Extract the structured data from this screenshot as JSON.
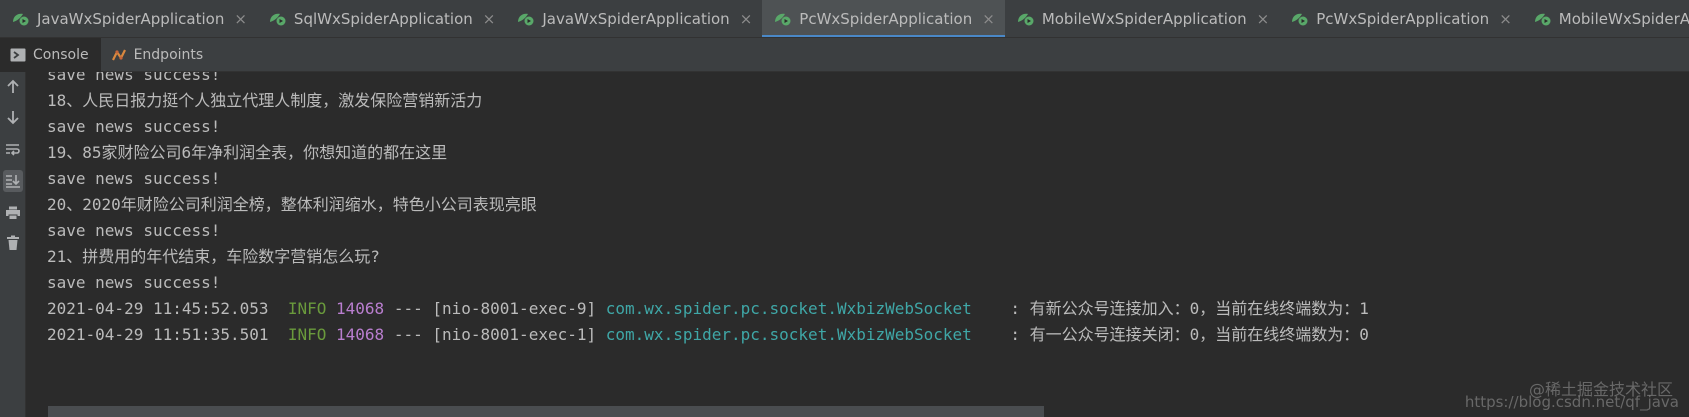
{
  "run_tabs": [
    {
      "label": "JavaWxSpiderApplication",
      "active": false
    },
    {
      "label": "SqlWxSpiderApplication",
      "active": false
    },
    {
      "label": "JavaWxSpiderApplication",
      "active": false
    },
    {
      "label": "PcWxSpiderApplication",
      "active": true
    },
    {
      "label": "MobileWxSpiderApplication",
      "active": false
    },
    {
      "label": "PcWxSpiderApplication",
      "active": false
    },
    {
      "label": "MobileWxSpiderApplication",
      "active": false
    }
  ],
  "tool_tabs": [
    {
      "label": "Console",
      "icon": "console-icon",
      "active": true
    },
    {
      "label": "Endpoints",
      "icon": "endpoints-icon",
      "active": false
    }
  ],
  "gutter_buttons": [
    {
      "name": "up-arrow-icon"
    },
    {
      "name": "down-arrow-icon"
    },
    {
      "name": "soft-wrap-icon"
    },
    {
      "name": "scroll-to-end-icon",
      "pressed": true
    },
    {
      "name": "print-icon"
    },
    {
      "name": "trash-icon"
    }
  ],
  "console": {
    "lines": [
      {
        "text": "save news success!"
      },
      {
        "text": "18、人民日报力挺个人独立代理人制度，激发保险营销新活力"
      },
      {
        "text": "save news success!"
      },
      {
        "text": "19、85家财险公司6年净利润全表，你想知道的都在这里"
      },
      {
        "text": "save news success!"
      },
      {
        "text": "20、2020年财险公司利润全榜，整体利润缩水，特色小公司表现亮眼"
      },
      {
        "text": "save news success!"
      },
      {
        "text": "21、拼费用的年代结束，车险数字营销怎么玩?"
      },
      {
        "text": "save news success!"
      }
    ],
    "log_lines": [
      {
        "timestamp": "2021-04-29 11:45:52.053",
        "level": "INFO",
        "pid": "14068",
        "sep": "---",
        "thread": "[nio-8001-exec-9]",
        "logger": "com.wx.spider.pc.socket.WxbizWebSocket",
        "message": ": 有新公众号连接加入：0，当前在线终端数为：1"
      },
      {
        "timestamp": "2021-04-29 11:51:35.501",
        "level": "INFO",
        "pid": "14068",
        "sep": "---",
        "thread": "[nio-8001-exec-1]",
        "logger": "com.wx.spider.pc.socket.WxbizWebSocket",
        "message": ": 有一公众号连接关闭：0，当前在线终端数为：0"
      }
    ]
  },
  "watermark": {
    "line1": "@稀土掘金技术社区",
    "line2": "https://blog.csdn.net/qf_java"
  },
  "colors": {
    "background": "#2b2b2b",
    "panel": "#3c3f41",
    "accent": "#4a88c7",
    "info": "#6a9a3c",
    "pid": "#b97ecf",
    "logger": "#3fa7a7"
  }
}
